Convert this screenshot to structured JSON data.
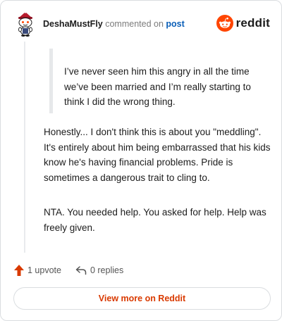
{
  "header": {
    "username": "DeshaMustFly",
    "action_text": "commented on",
    "post_link": "post",
    "brand_word": "reddit"
  },
  "colors": {
    "accent": "#ff4500",
    "link": "#0a5fb8",
    "button_text": "#d93a00"
  },
  "comment": {
    "quote": "I’ve never seen him this angry in all the time we’ve been married and I’m really starting to think I did the wrong thing.",
    "paragraphs": [
      "Honestly... I don't think this is about you \"meddling\". It's entirely about him being embarrassed that his kids know he's having financial problems. Pride is sometimes a dangerous trait to cling to.",
      "NTA. You needed help. You asked for help. Help was freely given."
    ]
  },
  "footer": {
    "upvote_label": "1 upvote",
    "replies_label": "0 replies",
    "view_button": "View more on Reddit"
  },
  "icons": {
    "avatar": "snoo-avatar-icon",
    "brand": "reddit-logo-icon",
    "upvote": "upvote-arrow-icon",
    "reply": "reply-arrow-icon"
  }
}
